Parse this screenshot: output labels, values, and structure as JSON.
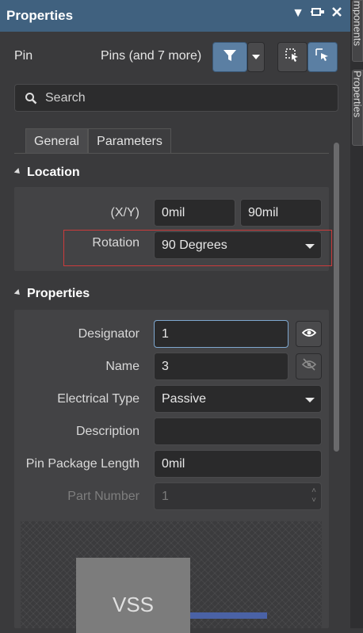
{
  "panel": {
    "title": "Properties",
    "title_bg": "#40617f"
  },
  "dock_tabs": [
    "mponents",
    "Properties"
  ],
  "header": {
    "object_kind": "Pin",
    "selection_summary": "Pins (and 7 more)",
    "filter_icon": "filter-icon",
    "select_icons": [
      "select-inside-icon",
      "select-cursor-icon"
    ]
  },
  "search": {
    "placeholder": "Search"
  },
  "tabs": [
    {
      "label": "General",
      "selected": true
    },
    {
      "label": "Parameters",
      "selected": false
    }
  ],
  "location": {
    "heading": "Location",
    "xy_label": "(X/Y)",
    "x_value": "0mil",
    "y_value": "90mil",
    "rotation_label": "Rotation",
    "rotation_value": "90 Degrees"
  },
  "properties": {
    "heading": "Properties",
    "designator_label": "Designator",
    "designator_value": "1",
    "name_label": "Name",
    "name_value": "3",
    "electrical_type_label": "Electrical Type",
    "electrical_type_value": "Passive",
    "description_label": "Description",
    "description_value": "",
    "pin_package_length_label": "Pin Package Length",
    "pin_package_length_value": "0mil",
    "part_number_label": "Part Number",
    "part_number_value": "1"
  },
  "preview": {
    "component_label": "VSS",
    "pin_color": "#4a62a6",
    "highlight_color": "#cc3b3b"
  }
}
